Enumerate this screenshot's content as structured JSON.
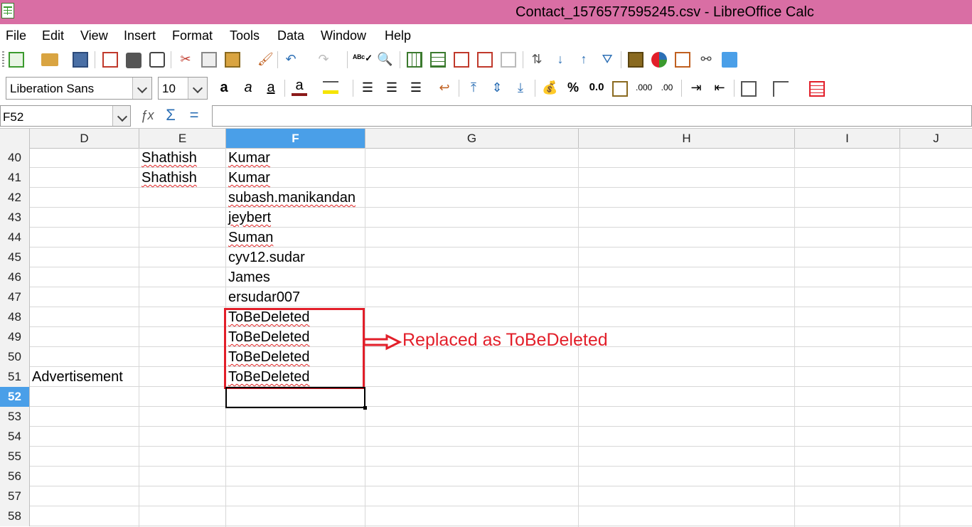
{
  "window": {
    "title": "Contact_1576577595245.csv - LibreOffice Calc"
  },
  "menu": [
    "File",
    "Edit",
    "View",
    "Insert",
    "Format",
    "Tools",
    "Data",
    "Window",
    "Help"
  ],
  "format_toolbar": {
    "font_name": "Liberation Sans",
    "font_size": "10",
    "percent_label": "%",
    "decimal_label": "0.0"
  },
  "formula_bar": {
    "cell_ref": "F52",
    "formula": ""
  },
  "columns": [
    "D",
    "E",
    "F",
    "G",
    "H",
    "I",
    "J"
  ],
  "selected_column": "F",
  "selected_row": "52",
  "rows": [
    {
      "num": "40",
      "D": "",
      "E": "Shathish",
      "F": "Kumar"
    },
    {
      "num": "41",
      "D": "",
      "E": "Shathish",
      "F": "Kumar"
    },
    {
      "num": "42",
      "D": "",
      "E": "",
      "F": "subash.manikandan"
    },
    {
      "num": "43",
      "D": "",
      "E": "",
      "F": "jeybert"
    },
    {
      "num": "44",
      "D": "",
      "E": "",
      "F": "Suman"
    },
    {
      "num": "45",
      "D": "",
      "E": "",
      "F": "cyv12.sudar"
    },
    {
      "num": "46",
      "D": "",
      "E": "",
      "F": "James"
    },
    {
      "num": "47",
      "D": "",
      "E": "",
      "F": "ersudar007"
    },
    {
      "num": "48",
      "D": "",
      "E": "",
      "F": "ToBeDeleted"
    },
    {
      "num": "49",
      "D": "",
      "E": "",
      "F": "ToBeDeleted"
    },
    {
      "num": "50",
      "D": "",
      "E": "",
      "F": "ToBeDeleted"
    },
    {
      "num": "51",
      "D": "Advertisement",
      "E": "",
      "F": "ToBeDeleted"
    },
    {
      "num": "52",
      "D": "",
      "E": "",
      "F": ""
    },
    {
      "num": "53",
      "D": "",
      "E": "",
      "F": ""
    },
    {
      "num": "54",
      "D": "",
      "E": "",
      "F": ""
    },
    {
      "num": "55",
      "D": "",
      "E": "",
      "F": ""
    },
    {
      "num": "56",
      "D": "",
      "E": "",
      "F": ""
    },
    {
      "num": "57",
      "D": "",
      "E": "",
      "F": ""
    },
    {
      "num": "58",
      "D": "",
      "E": "",
      "F": ""
    }
  ],
  "annotation": {
    "text": "Replaced as ToBeDeleted",
    "color": "#e21f2a"
  },
  "colors": {
    "titlebar": "#d96ea4",
    "selection_header": "#4a9fe8"
  }
}
